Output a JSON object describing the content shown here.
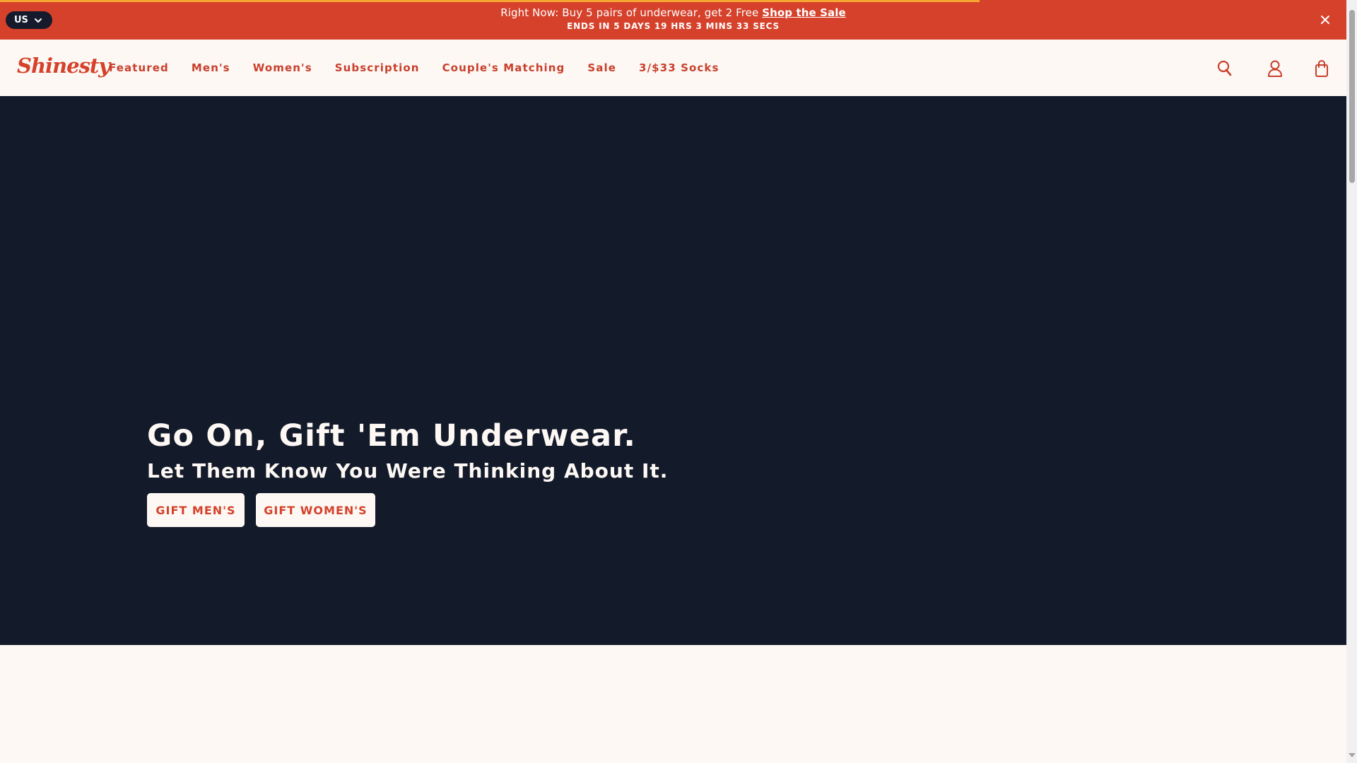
{
  "promo": {
    "text": "Right Now: Buy 5 pairs of underwear, get 2 Free",
    "link": "Shop the Sale",
    "countdown": "ENDS IN 5 DAYS 19 HRS 3 MINS 33 SECS",
    "region": "US",
    "close_icon": "close-icon"
  },
  "header": {
    "logo": "Shinesty",
    "nav": [
      "Featured",
      "Men's",
      "Women's",
      "Subscription",
      "Couple's Matching",
      "Sale",
      "3/$33 Socks"
    ],
    "icons": [
      "search-icon",
      "user-icon",
      "bag-icon"
    ]
  },
  "hero": {
    "title": "Go On, Gift 'Em Underwear.",
    "subtitle": "Let Them Know You Were Thinking About It.",
    "button_men": "GIFT MEN'S",
    "button_women": "GIFT WOMEN'S"
  },
  "colors": {
    "brand": "#d5412a",
    "navy": "#131a2a",
    "cream": "#fdf8f4",
    "accent": "#f6a630"
  }
}
